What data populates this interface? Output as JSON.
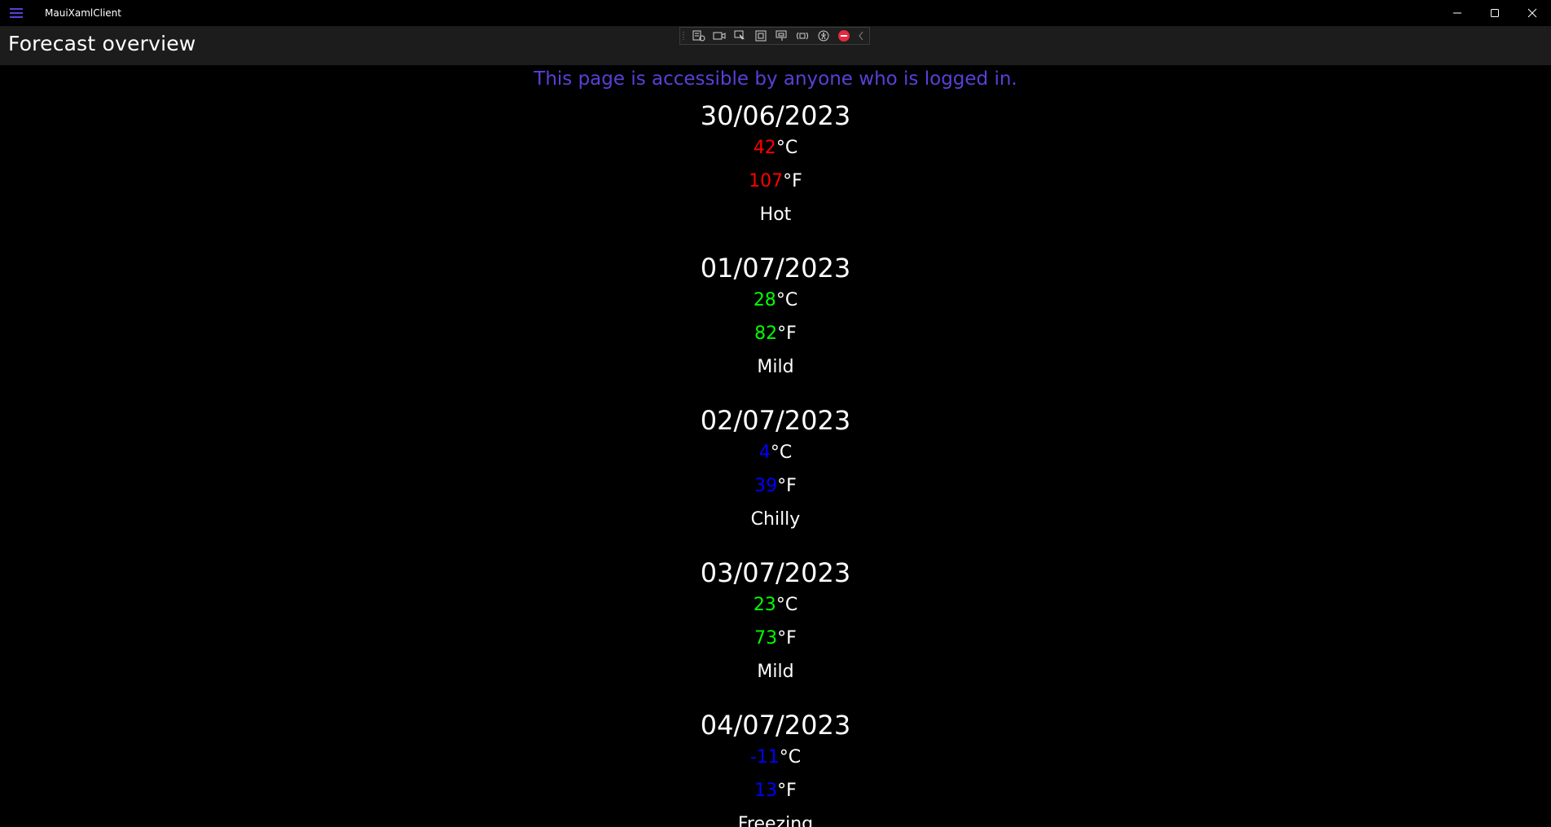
{
  "window": {
    "title": "MauiXamlClient",
    "controls": {
      "minimize_icon": "minimize-icon",
      "maximize_icon": "maximize-icon",
      "close_icon": "close-icon"
    }
  },
  "header": {
    "title": "Forecast overview"
  },
  "debug_toolbar": {
    "icons": [
      "go-to-live-visual-tree-icon",
      "show-in-app-toolbar-icon",
      "select-element-icon",
      "display-layout-adorners-icon",
      "track-focused-element-icon",
      "hot-reload-icon",
      "accessibility-checker-icon",
      "stop-icon",
      "collapse-icon"
    ]
  },
  "notice": "This page is accessible by anyone who is logged in.",
  "colors": {
    "accent": "#5b3fd8",
    "hot": "#ff0000",
    "mild": "#00ff00",
    "cold": "#0000ff",
    "text": "#ffffff",
    "header_bg": "#1c1c1c"
  },
  "forecasts": [
    {
      "date": "30/06/2023",
      "temp_c": "42",
      "temp_f": "107",
      "summary": "Hot",
      "color": "#ff0000"
    },
    {
      "date": "01/07/2023",
      "temp_c": "28",
      "temp_f": "82",
      "summary": "Mild",
      "color": "#00ff00"
    },
    {
      "date": "02/07/2023",
      "temp_c": "4",
      "temp_f": "39",
      "summary": "Chilly",
      "color": "#0000ff"
    },
    {
      "date": "03/07/2023",
      "temp_c": "23",
      "temp_f": "73",
      "summary": "Mild",
      "color": "#00ff00"
    },
    {
      "date": "04/07/2023",
      "temp_c": "-11",
      "temp_f": "13",
      "summary": "Freezing",
      "color": "#0000ff"
    }
  ],
  "units": {
    "celsius": "°C",
    "fahrenheit": "°F"
  }
}
